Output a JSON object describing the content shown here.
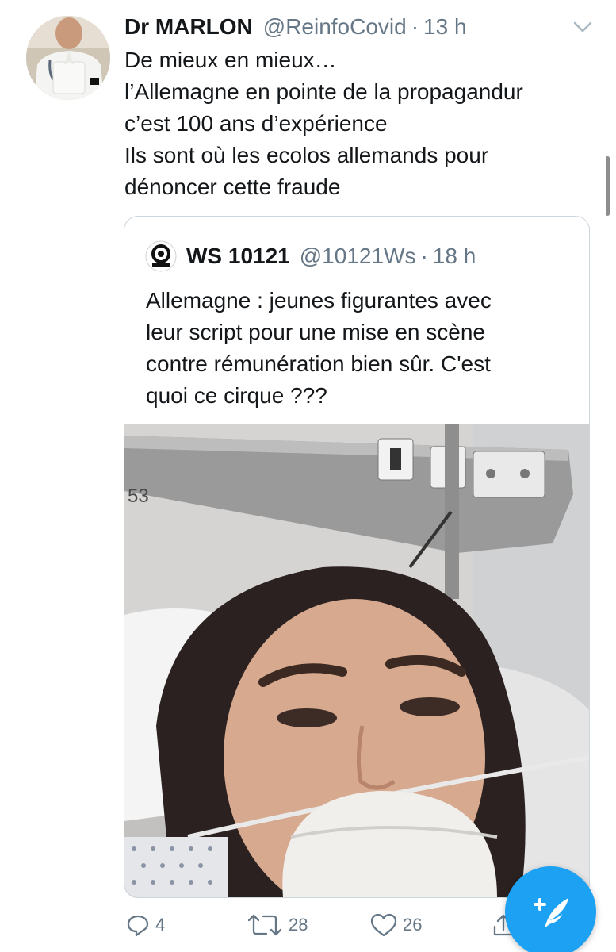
{
  "tweet": {
    "author_name": "Dr MARLON",
    "handle": "@ReinfoCovid",
    "separator": "·",
    "time": "13 h",
    "text_lines": [
      "De mieux en mieux…",
      "l’Allemagne en pointe de la propagandur",
      "c’est 100 ans d’expérience",
      "Ils sont où les ecolos allemands pour",
      "dénoncer cette fraude"
    ],
    "avatar_icon": "doctor-avatar",
    "menu_icon": "chevron-down-icon"
  },
  "quoted_tweet": {
    "author_name": "WS 10121",
    "handle": "@10121Ws",
    "separator": "·",
    "time": "18 h",
    "text_lines": [
      "Allemagne : jeunes figurantes avec",
      "leur script pour une mise en scène",
      "contre rémunération bien sûr. C'est",
      "quoi ce cirque ???"
    ],
    "media_description_icon": "video-thumbnail",
    "media_wall_number": "53"
  },
  "actions": {
    "replies": "4",
    "retweets": "28",
    "likes": "26"
  },
  "colors": {
    "accent": "#1da1f2",
    "secondary_text": "#657786",
    "primary_text": "#14171a",
    "border": "#ccd6dd"
  },
  "compose_button": {
    "icon": "compose-tweet-icon"
  }
}
